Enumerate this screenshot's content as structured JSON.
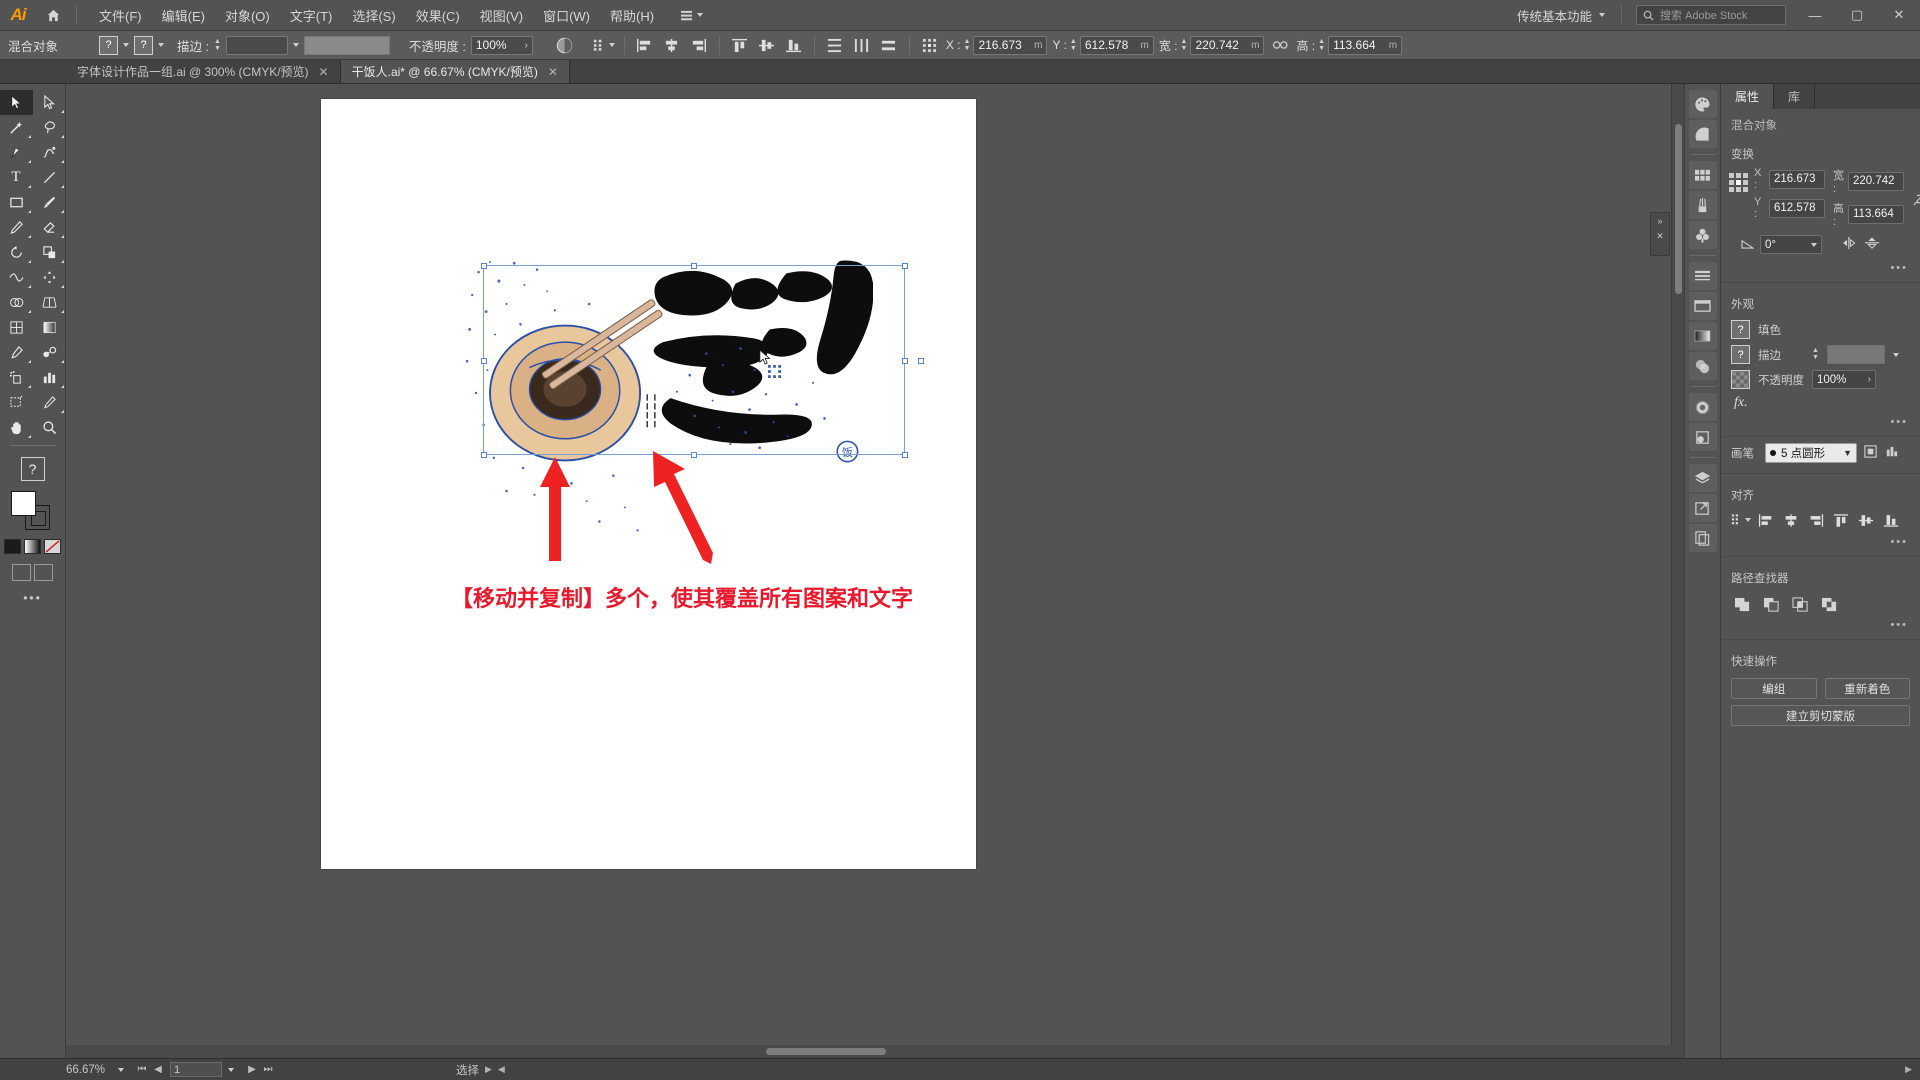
{
  "app": {
    "name": "Adobe Illustrator",
    "logo_text": "Ai"
  },
  "menubar": {
    "home_icon": "home-icon",
    "items": [
      {
        "label": "文件(F)"
      },
      {
        "label": "编辑(E)"
      },
      {
        "label": "对象(O)"
      },
      {
        "label": "文字(T)"
      },
      {
        "label": "选择(S)"
      },
      {
        "label": "效果(C)"
      },
      {
        "label": "视图(V)"
      },
      {
        "label": "窗口(W)"
      },
      {
        "label": "帮助(H)"
      }
    ],
    "more_label": "",
    "workspace": "传统基本功能",
    "search_placeholder": "搜索 Adobe Stock",
    "window_controls": {
      "minimize": "—",
      "maximize": "▢",
      "close": "✕"
    }
  },
  "controlbar": {
    "object_label": "混合对象",
    "fill_swatch": "?",
    "stroke_swatch": "?",
    "stroke_label": "描边 :",
    "stroke_weight": "",
    "opacity_label": "不透明度 :",
    "opacity_value": "100%",
    "x_label": "X :",
    "x_value": "216.673",
    "x_unit": "m",
    "y_label": "Y :",
    "y_value": "612.578",
    "y_unit": "m",
    "w_label": "宽 :",
    "w_value": "220.742",
    "w_unit": "m",
    "h_label": "高 :",
    "h_value": "113.664",
    "h_unit": "m"
  },
  "tabs": [
    {
      "label": "字体设计作品一组.ai @ 300% (CMYK/预览)",
      "active": false,
      "close": "✕"
    },
    {
      "label": "干饭人.ai* @ 66.67% (CMYK/预览)",
      "active": true,
      "close": "✕"
    }
  ],
  "toolbar": {
    "tools": [
      {
        "name": "selection-tool",
        "glyph": "➤",
        "selected": true
      },
      {
        "name": "direct-selection-tool",
        "glyph": "➢",
        "selected": false
      },
      {
        "name": "magic-wand-tool",
        "glyph": "✦",
        "selected": false
      },
      {
        "name": "lasso-tool",
        "glyph": "◠",
        "selected": false
      },
      {
        "name": "pen-tool",
        "glyph": "✒",
        "selected": false
      },
      {
        "name": "curvature-tool",
        "glyph": "✎",
        "selected": false
      },
      {
        "name": "type-tool",
        "glyph": "T",
        "selected": false
      },
      {
        "name": "line-segment-tool",
        "glyph": "╱",
        "selected": false
      },
      {
        "name": "rectangle-tool",
        "glyph": "▭",
        "selected": false
      },
      {
        "name": "paintbrush-tool",
        "glyph": "🖌",
        "selected": false
      },
      {
        "name": "shaper-tool",
        "glyph": "✏",
        "selected": false
      },
      {
        "name": "eraser-tool",
        "glyph": "◇",
        "selected": false
      },
      {
        "name": "rotate-tool",
        "glyph": "↺",
        "selected": false
      },
      {
        "name": "scale-tool",
        "glyph": "⬓",
        "selected": false
      },
      {
        "name": "width-tool",
        "glyph": "≋",
        "selected": false
      },
      {
        "name": "free-transform-tool",
        "glyph": "✜",
        "selected": false
      },
      {
        "name": "shape-builder-tool",
        "glyph": "◕",
        "selected": false
      },
      {
        "name": "perspective-grid-tool",
        "glyph": "◫",
        "selected": false
      },
      {
        "name": "mesh-tool",
        "glyph": "▦",
        "selected": false
      },
      {
        "name": "gradient-tool",
        "glyph": "▤",
        "selected": false
      },
      {
        "name": "eyedropper-tool",
        "glyph": "⚲",
        "selected": false
      },
      {
        "name": "blend-tool",
        "glyph": "☍",
        "selected": false
      },
      {
        "name": "symbol-sprayer-tool",
        "glyph": "⁂",
        "selected": false
      },
      {
        "name": "column-graph-tool",
        "glyph": "▥",
        "selected": false
      },
      {
        "name": "artboard-tool",
        "glyph": "⬒",
        "selected": false
      },
      {
        "name": "slice-tool",
        "glyph": "✂",
        "selected": false
      },
      {
        "name": "hand-tool",
        "glyph": "✋",
        "selected": false
      },
      {
        "name": "zoom-tool",
        "glyph": "🔍",
        "selected": false
      }
    ],
    "help_glyph": "?",
    "fill_color": "#ffffff",
    "stroke_color": "#000000"
  },
  "canvas": {
    "annotation_text": "【移动并复制】多个，使其覆盖所有图案和文字",
    "annotation_color": "#e8192c",
    "arrow_color": "#ee2222",
    "selection_border_color": "#7a9fd4",
    "artwork_alt": "干饭人 calligraphy artwork with noodle bowl and chopsticks"
  },
  "icondock": {
    "icons": [
      {
        "name": "color-icon",
        "glyph": "◕"
      },
      {
        "name": "color-guide-icon",
        "glyph": "◓"
      },
      {
        "name": "swatches-icon",
        "glyph": "▦"
      },
      {
        "name": "brushes-icon",
        "glyph": "🖌"
      },
      {
        "name": "symbols-icon",
        "glyph": "♣"
      },
      {
        "name": "stroke-icon",
        "glyph": "☰"
      },
      {
        "name": "artboards-icon",
        "glyph": "▭"
      },
      {
        "name": "gradient-icon",
        "glyph": "▥"
      },
      {
        "name": "transparency-icon",
        "glyph": "◍"
      },
      {
        "name": "appearance-icon",
        "glyph": "◉"
      },
      {
        "name": "graphic-styles-icon",
        "glyph": "◰"
      },
      {
        "name": "layers-icon",
        "glyph": "◆"
      },
      {
        "name": "links-icon",
        "glyph": "⬈"
      },
      {
        "name": "document-info-icon",
        "glyph": "❐"
      }
    ],
    "mini_close": "✕"
  },
  "properties": {
    "tabs": [
      {
        "label": "属性",
        "active": true
      },
      {
        "label": "库",
        "active": false
      }
    ],
    "object_type": "混合对象",
    "transform": {
      "title": "变换",
      "x_label": "X :",
      "x_value": "216.673",
      "y_label": "Y :",
      "y_value": "612.578",
      "w_label": "宽 :",
      "w_value": "220.742",
      "h_label": "高 :",
      "h_value": "113.664",
      "angle_value": "0°",
      "link_icon": "unlink-icon"
    },
    "appearance": {
      "title": "外观",
      "fill_label": "填色",
      "fill_swatch": "?",
      "stroke_label": "描边",
      "stroke_swatch": "?",
      "opacity_label": "不透明度",
      "opacity_value": "100%",
      "fx_label": "fx."
    },
    "brush": {
      "label": "画笔",
      "value": "5 点圆形"
    },
    "align": {
      "title": "对齐"
    },
    "pathfinder": {
      "title": "路径查找器"
    },
    "quick_actions": {
      "title": "快速操作",
      "buttons": [
        {
          "label": "编组"
        },
        {
          "label": "重新着色"
        },
        {
          "label": "建立剪切蒙版"
        }
      ]
    },
    "ellipsis": "•••"
  },
  "statusbar": {
    "zoom": "66.67%",
    "page": "1",
    "tool_status": "选择",
    "first_glyph": "⏮",
    "prev_glyph": "◀",
    "next_glyph": "▶",
    "last_glyph": "⏭"
  }
}
